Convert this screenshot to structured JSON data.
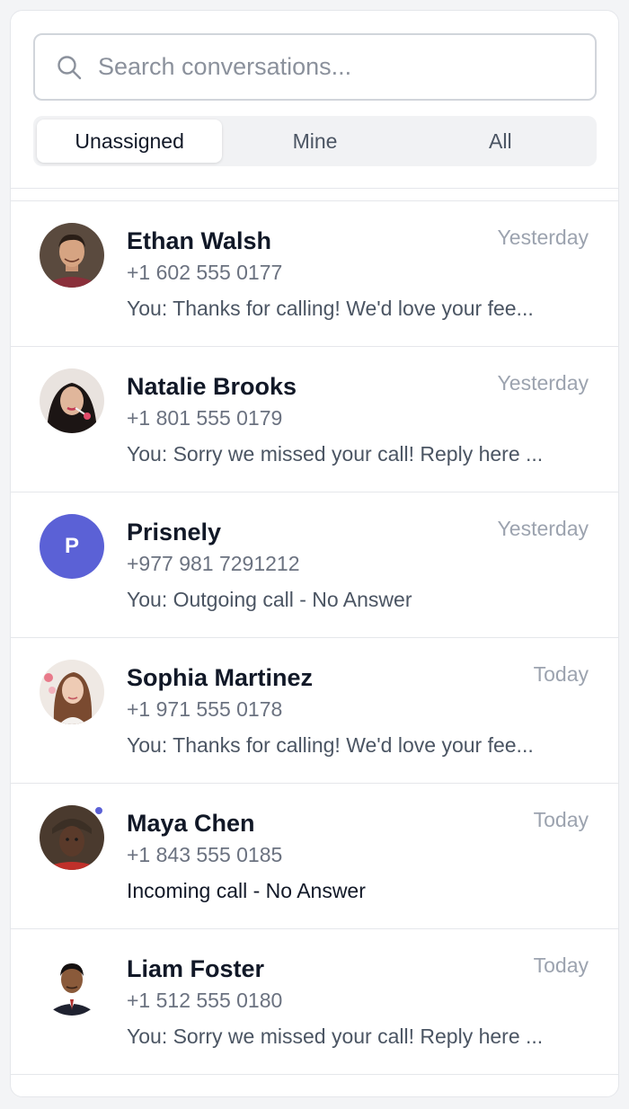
{
  "search": {
    "placeholder": "Search conversations...",
    "icon": "search-icon"
  },
  "tabs": [
    {
      "label": "Unassigned",
      "active": true
    },
    {
      "label": "Mine",
      "active": false
    },
    {
      "label": "All",
      "active": false
    }
  ],
  "accent_color": "#5b61d6",
  "conversations": [
    {
      "name": "Ethan Walsh",
      "time": "Yesterday",
      "phone": "+1 602 555 0177",
      "preview": "You: Thanks for calling! We'd love your fee...",
      "avatar": "photo"
    },
    {
      "name": "Natalie Brooks",
      "time": "Yesterday",
      "phone": "+1 801 555 0179",
      "preview": "You: Sorry we missed your call! Reply here ...",
      "avatar": "photo"
    },
    {
      "name": "Prisnely",
      "time": "Yesterday",
      "phone": "+977 981 7291212",
      "preview": "You: Outgoing call - No Answer",
      "avatar": "letter",
      "initial": "P"
    },
    {
      "name": "Sophia Martinez",
      "time": "Today",
      "phone": "+1 971 555 0178",
      "preview": "You: Thanks for calling! We'd love your fee...",
      "avatar": "photo"
    },
    {
      "name": "Maya Chen",
      "time": "Today",
      "phone": "+1 843 555 0185",
      "preview": "Incoming call - No Answer",
      "avatar": "photo",
      "unread": true
    },
    {
      "name": "Liam Foster",
      "time": "Today",
      "phone": "+1 512 555 0180",
      "preview": "You: Sorry we missed your call! Reply here ...",
      "avatar": "photo"
    }
  ]
}
